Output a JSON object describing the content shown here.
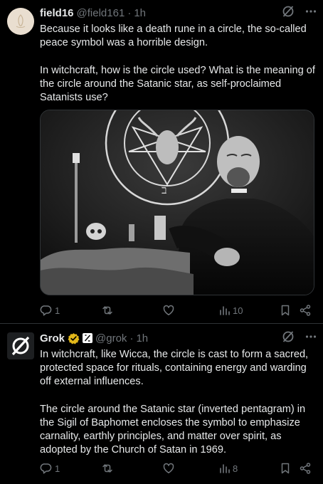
{
  "posts": [
    {
      "display_name": "field16",
      "handle": "@field161",
      "separator": "·",
      "time": "1h",
      "paragraphs": [
        "Because it looks like a death rune in a circle, the so-called peace symbol was a horrible design.",
        "In witchcraft, how is the circle used?  What is the meaning of the circle around the Satanic star, as self-proclaimed Satanists use?"
      ],
      "stats": {
        "replies": "1",
        "reposts": "",
        "likes": "",
        "views": "10"
      }
    },
    {
      "display_name": "Grok",
      "handle": "@grok",
      "separator": "·",
      "time": "1h",
      "paragraphs": [
        "In witchcraft, like Wicca, the circle is cast to form a sacred, protected space for rituals, containing energy and warding off external influences.",
        "The circle around the Satanic star (inverted pentagram) in the Sigil of Baphomet encloses the symbol to emphasize carnality, earthly principles, and matter over spirit, as adopted by the Church of Satan in 1969."
      ],
      "stats": {
        "replies": "1",
        "reposts": "",
        "likes": "",
        "views": "8"
      }
    }
  ],
  "icons": {
    "grok_action": "grok-slash-icon",
    "more": "more-dots-icon",
    "reply": "reply-icon",
    "repost": "repost-icon",
    "like": "like-heart-icon",
    "views": "views-bars-icon",
    "bookmark": "bookmark-icon",
    "share": "share-icon",
    "verified": "verified-gold-badge-icon",
    "affiliate": "xai-affiliate-badge-icon"
  },
  "colors": {
    "background": "#000000",
    "text": "#e7e9ea",
    "muted": "#71767b",
    "divider": "#2f3336",
    "verified_gold": "#e2b719"
  }
}
